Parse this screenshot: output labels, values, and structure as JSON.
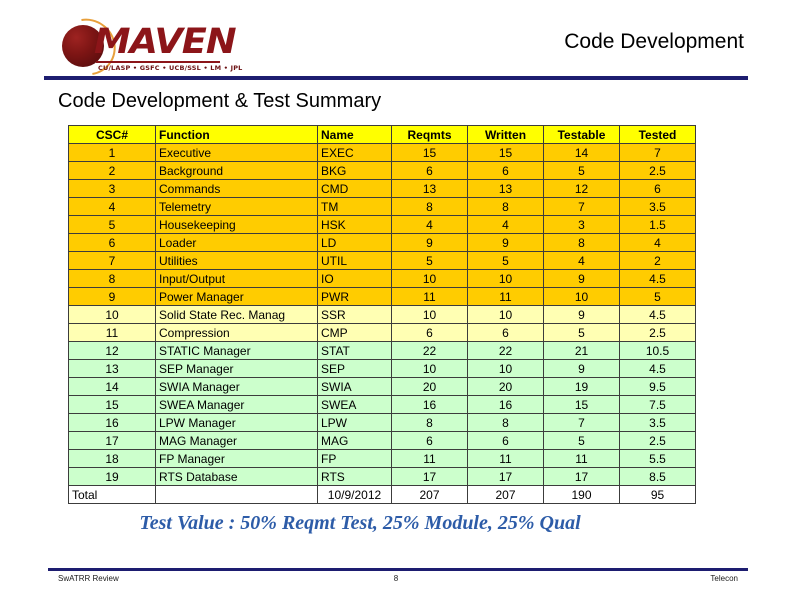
{
  "header": {
    "title": "Code Development",
    "logo": {
      "wordmark": "MAVEN",
      "partners": "CU/LASP • GSFC • UCB/SSL • LM • JPL"
    },
    "divider_color": "#1d1d70"
  },
  "section_heading": "Code Development & Test Summary",
  "table": {
    "columns": [
      "CSC#",
      "Function",
      "Name",
      "Reqmts",
      "Written",
      "Testable",
      "Tested"
    ],
    "header_bg": "#ffff00",
    "band_colors": {
      "gold": "#ffcc00",
      "yellow": "#ffffb3",
      "green": "#ccffcc",
      "total": "#ffffff"
    },
    "rows": [
      {
        "band": "gold",
        "csc": "1",
        "function": "Executive",
        "name": "EXEC",
        "reqmts": "15",
        "written": "15",
        "testable": "14",
        "tested": "7"
      },
      {
        "band": "gold",
        "csc": "2",
        "function": "Background",
        "name": "BKG",
        "reqmts": "6",
        "written": "6",
        "testable": "5",
        "tested": "2.5"
      },
      {
        "band": "gold",
        "csc": "3",
        "function": "Commands",
        "name": "CMD",
        "reqmts": "13",
        "written": "13",
        "testable": "12",
        "tested": "6"
      },
      {
        "band": "gold",
        "csc": "4",
        "function": "Telemetry",
        "name": "TM",
        "reqmts": "8",
        "written": "8",
        "testable": "7",
        "tested": "3.5"
      },
      {
        "band": "gold",
        "csc": "5",
        "function": "Housekeeping",
        "name": "HSK",
        "reqmts": "4",
        "written": "4",
        "testable": "3",
        "tested": "1.5"
      },
      {
        "band": "gold",
        "csc": "6",
        "function": "Loader",
        "name": "LD",
        "reqmts": "9",
        "written": "9",
        "testable": "8",
        "tested": "4"
      },
      {
        "band": "gold",
        "csc": "7",
        "function": "Utilities",
        "name": "UTIL",
        "reqmts": "5",
        "written": "5",
        "testable": "4",
        "tested": "2"
      },
      {
        "band": "gold",
        "csc": "8",
        "function": "Input/Output",
        "name": "IO",
        "reqmts": "10",
        "written": "10",
        "testable": "9",
        "tested": "4.5"
      },
      {
        "band": "gold",
        "csc": "9",
        "function": "Power Manager",
        "name": "PWR",
        "reqmts": "11",
        "written": "11",
        "testable": "10",
        "tested": "5"
      },
      {
        "band": "yellow",
        "csc": "10",
        "function": "Solid State Rec. Manag",
        "name": "SSR",
        "reqmts": "10",
        "written": "10",
        "testable": "9",
        "tested": "4.5"
      },
      {
        "band": "yellow",
        "csc": "11",
        "function": "Compression",
        "name": "CMP",
        "reqmts": "6",
        "written": "6",
        "testable": "5",
        "tested": "2.5"
      },
      {
        "band": "green",
        "csc": "12",
        "function": "STATIC Manager",
        "name": "STAT",
        "reqmts": "22",
        "written": "22",
        "testable": "21",
        "tested": "10.5"
      },
      {
        "band": "green",
        "csc": "13",
        "function": "SEP Manager",
        "name": "SEP",
        "reqmts": "10",
        "written": "10",
        "testable": "9",
        "tested": "4.5"
      },
      {
        "band": "green",
        "csc": "14",
        "function": "SWIA Manager",
        "name": "SWIA",
        "reqmts": "20",
        "written": "20",
        "testable": "19",
        "tested": "9.5"
      },
      {
        "band": "green",
        "csc": "15",
        "function": "SWEA Manager",
        "name": "SWEA",
        "reqmts": "16",
        "written": "16",
        "testable": "15",
        "tested": "7.5"
      },
      {
        "band": "green",
        "csc": "16",
        "function": "LPW Manager",
        "name": "LPW",
        "reqmts": "8",
        "written": "8",
        "testable": "7",
        "tested": "3.5"
      },
      {
        "band": "green",
        "csc": "17",
        "function": "MAG Manager",
        "name": "MAG",
        "reqmts": "6",
        "written": "6",
        "testable": "5",
        "tested": "2.5"
      },
      {
        "band": "green",
        "csc": "18",
        "function": "FP Manager",
        "name": "FP",
        "reqmts": "11",
        "written": "11",
        "testable": "11",
        "tested": "5.5"
      },
      {
        "band": "green",
        "csc": "19",
        "function": "RTS Database",
        "name": "RTS",
        "reqmts": "17",
        "written": "17",
        "testable": "17",
        "tested": "8.5"
      },
      {
        "band": "total",
        "csc": "Total",
        "function": "",
        "name": "10/9/2012",
        "reqmts": "207",
        "written": "207",
        "testable": "190",
        "tested": "95"
      }
    ]
  },
  "caption": "Test Value : 50% Reqmt Test, 25% Module, 25% Qual",
  "caption_color": "#2d5ca8",
  "footer": {
    "left": "SwATRR Review",
    "page": "8",
    "right": "Telecon"
  }
}
